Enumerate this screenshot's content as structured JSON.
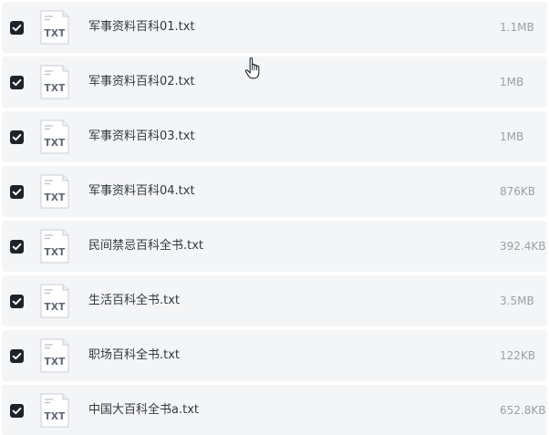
{
  "file_list": {
    "files": [
      {
        "name": "军事资料百科01.txt",
        "size": "1.1MB",
        "type": "TXT",
        "checked": true
      },
      {
        "name": "军事资料百科02.txt",
        "size": "1MB",
        "type": "TXT",
        "checked": true
      },
      {
        "name": "军事资料百科03.txt",
        "size": "1MB",
        "type": "TXT",
        "checked": true
      },
      {
        "name": "军事资料百科04.txt",
        "size": "876KB",
        "type": "TXT",
        "checked": true
      },
      {
        "name": "民间禁忌百科全书.txt",
        "size": "392.4KB",
        "type": "TXT",
        "checked": true
      },
      {
        "name": "生活百科全书.txt",
        "size": "3.5MB",
        "type": "TXT",
        "checked": true
      },
      {
        "name": "职场百科全书.txt",
        "size": "122KB",
        "type": "TXT",
        "checked": true
      },
      {
        "name": "中国大百科全书a.txt",
        "size": "652.8KB",
        "type": "TXT",
        "checked": true
      }
    ]
  },
  "icons": {
    "checkbox": "checkmark-icon",
    "file": "txt-file-icon",
    "cursor": "hand-pointer-cursor-icon"
  },
  "colors": {
    "row_background": "#f4f5f7",
    "checkbox_fill": "#1f2329",
    "file_name_text": "#33373d",
    "file_size_text": "#9aa0a8"
  }
}
